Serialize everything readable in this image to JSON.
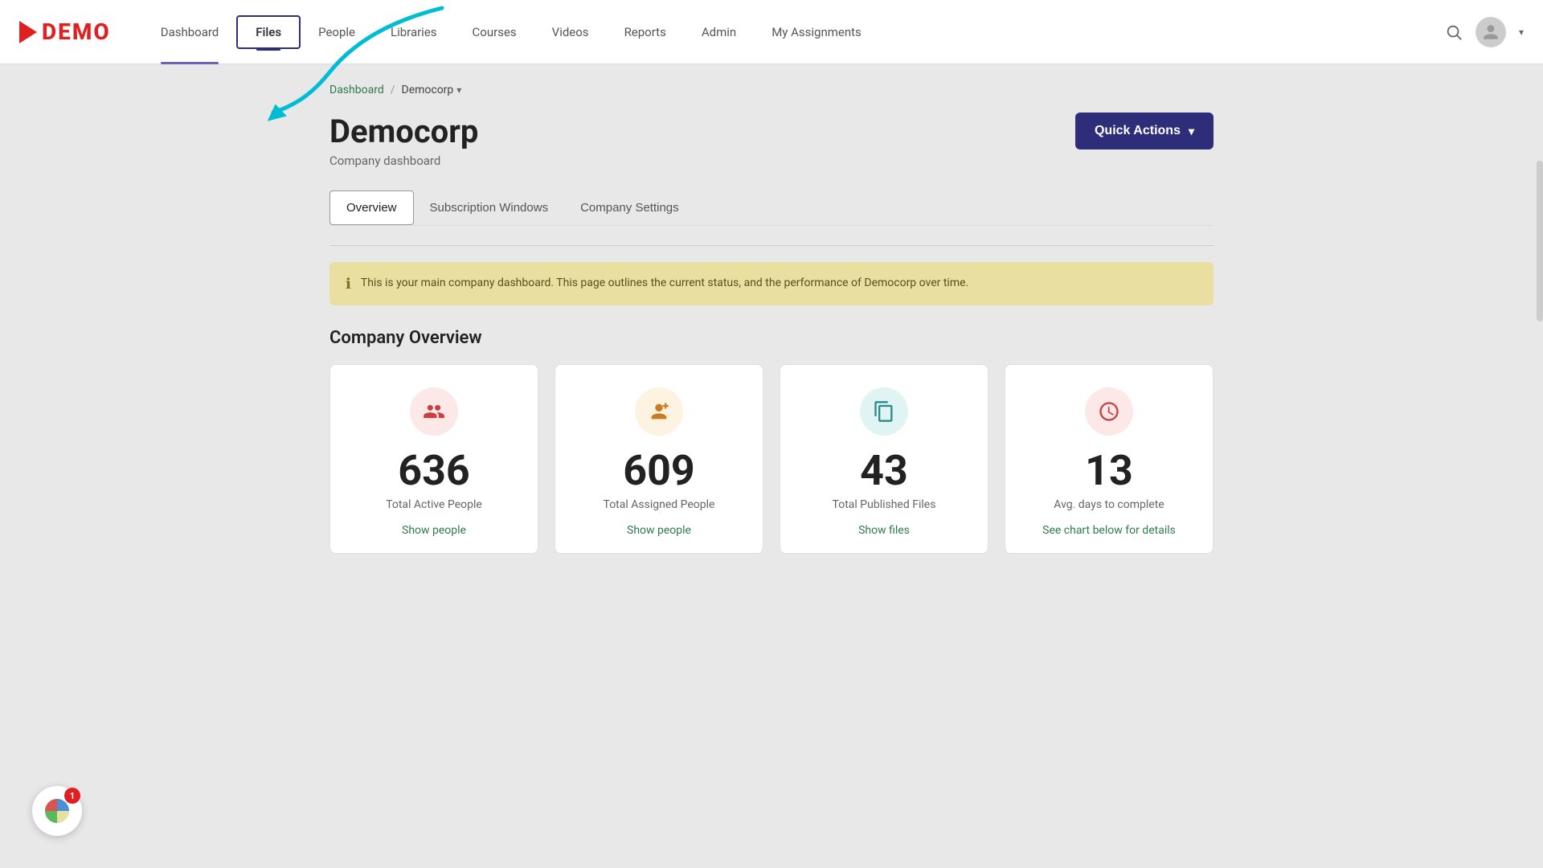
{
  "logo": {
    "text": "DEMO"
  },
  "nav": {
    "items": [
      {
        "label": "Dashboard",
        "id": "dashboard",
        "active": false,
        "underlined": true
      },
      {
        "label": "Files",
        "id": "files",
        "active": true
      },
      {
        "label": "People",
        "id": "people",
        "active": false
      },
      {
        "label": "Libraries",
        "id": "libraries",
        "active": false
      },
      {
        "label": "Courses",
        "id": "courses",
        "active": false
      },
      {
        "label": "Videos",
        "id": "videos",
        "active": false
      },
      {
        "label": "Reports",
        "id": "reports",
        "active": false
      },
      {
        "label": "Admin",
        "id": "admin",
        "active": false
      },
      {
        "label": "My Assignments",
        "id": "my-assignments",
        "active": false
      }
    ]
  },
  "breadcrumb": {
    "home": "Dashboard",
    "separator": "/",
    "current": "Democorp"
  },
  "page": {
    "title": "Democorp",
    "subtitle": "Company dashboard"
  },
  "quick_actions": {
    "label": "Quick Actions",
    "chevron": "▾"
  },
  "tabs": [
    {
      "label": "Overview",
      "active": true
    },
    {
      "label": "Subscription Windows",
      "active": false
    },
    {
      "label": "Company Settings",
      "active": false
    }
  ],
  "info_banner": {
    "icon": "ℹ",
    "text": "This is your main company dashboard. This page outlines the current status, and the performance of Democorp over time."
  },
  "company_overview": {
    "title": "Company Overview",
    "stats": [
      {
        "icon": "👥",
        "icon_style": "red",
        "number": "636",
        "label": "Total Active People",
        "link": "Show people"
      },
      {
        "icon": "👤",
        "icon_style": "yellow",
        "number": "609",
        "label": "Total Assigned People",
        "link": "Show people"
      },
      {
        "icon": "📋",
        "icon_style": "teal",
        "number": "43",
        "label": "Total Published Files",
        "link": "Show files"
      },
      {
        "icon": "🕐",
        "icon_style": "pink",
        "number": "13",
        "label": "Avg. days to complete",
        "link": "See chart below for details"
      }
    ]
  },
  "notification": {
    "badge_count": "1"
  }
}
